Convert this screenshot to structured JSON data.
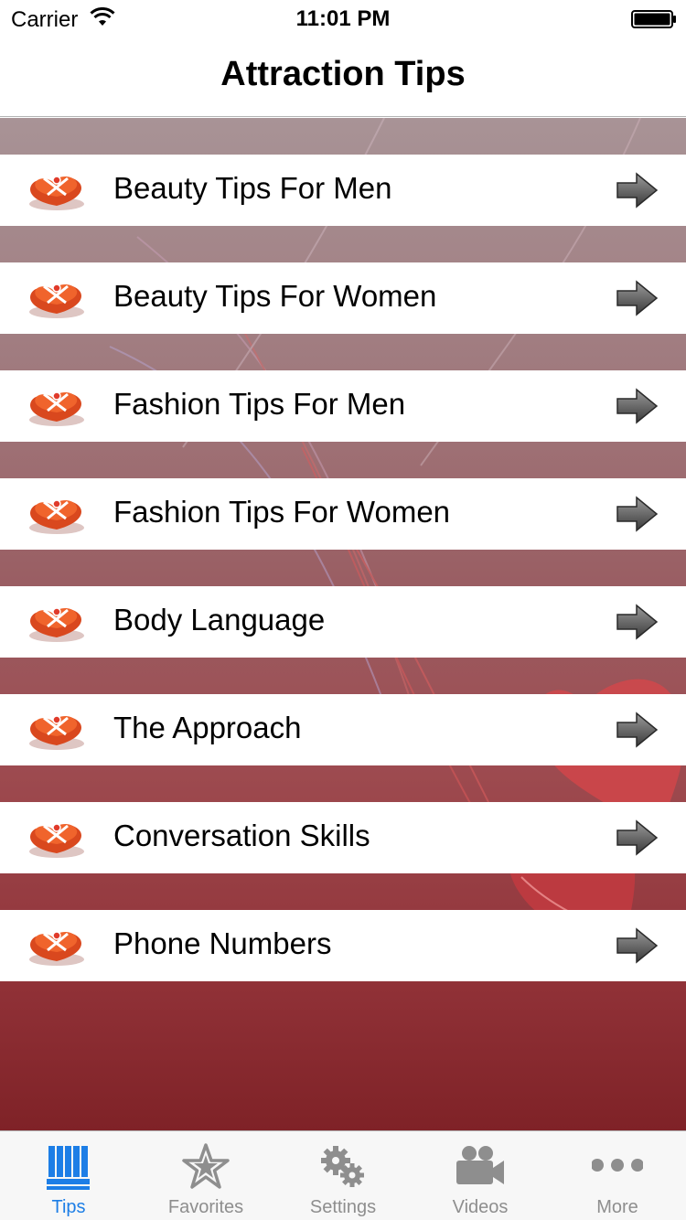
{
  "status_bar": {
    "carrier": "Carrier",
    "time": "11:01 PM",
    "wifi_icon": "wifi-icon",
    "battery_icon": "battery-icon"
  },
  "nav_bar": {
    "title": "Attraction Tips"
  },
  "colors": {
    "accent": "#1d7ee6",
    "tab_inactive": "#8e8e8e",
    "background_top": "#a89396",
    "background_bottom": "#7f2227"
  },
  "list": {
    "row_icon": "heart-gift-box-icon",
    "row_accessory_icon": "arrow-right-icon",
    "items": [
      {
        "label": "Beauty Tips For Men"
      },
      {
        "label": "Beauty Tips For Women"
      },
      {
        "label": "Fashion Tips For Men"
      },
      {
        "label": "Fashion Tips For Women"
      },
      {
        "label": "Body Language"
      },
      {
        "label": "The Approach"
      },
      {
        "label": "Conversation Skills"
      },
      {
        "label": "Phone Numbers"
      }
    ]
  },
  "tab_bar": {
    "selected": "Tips",
    "tabs": [
      {
        "label": "Tips",
        "icon": "books-icon"
      },
      {
        "label": "Favorites",
        "icon": "star-icon"
      },
      {
        "label": "Settings",
        "icon": "gears-icon"
      },
      {
        "label": "Videos",
        "icon": "video-camera-icon"
      },
      {
        "label": "More",
        "icon": "more-dots-icon"
      }
    ]
  }
}
